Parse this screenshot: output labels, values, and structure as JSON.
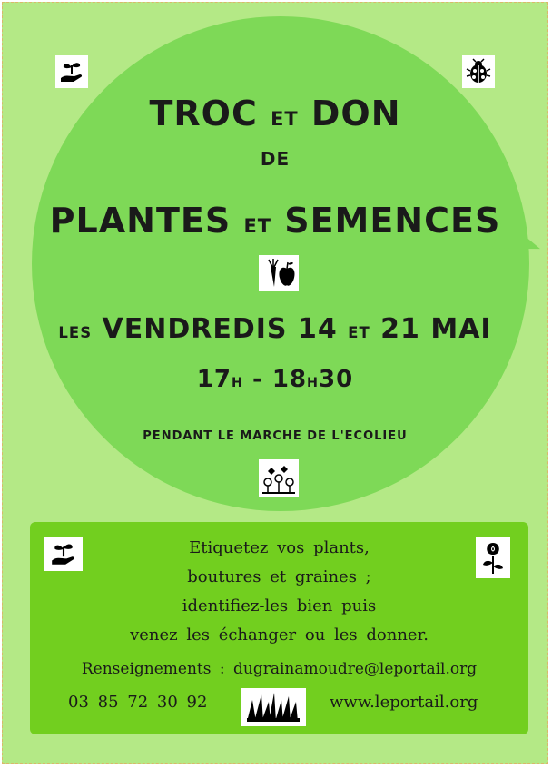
{
  "header": {
    "line1_a": "TROC",
    "line1_b": "ET",
    "line1_c": "DON",
    "line2": "DE",
    "line3_a": "PLANTES",
    "line3_b": "ET",
    "line3_c": "SEMENCES"
  },
  "dates": {
    "prefix": "LES",
    "main_a": "VENDREDIS 14",
    "mid": "ET",
    "main_b": "21 MAI"
  },
  "time": {
    "start": "17",
    "start_unit": "H",
    "dash": "-",
    "end_a": "18",
    "end_unit": "H",
    "end_b": "30"
  },
  "venue": "PENDANT LE MARCHE DE L'ECOLIEU",
  "panel": {
    "line1": "Etiquetez vos plants,",
    "line2": "boutures et graines ;",
    "line3": "identifiez-les bien puis",
    "line4": "venez les échanger ou les donner.",
    "info": "Renseignements : dugrainamoudre@leportail.org",
    "phone": "03 85 72 30 92",
    "website": "www.leportail.org"
  },
  "colors": {
    "background": "#b4e986",
    "bubble": "#7ed957",
    "panel": "#72cf1f",
    "text": "#1a1a1a"
  },
  "icons": [
    "seedling-hand-icon",
    "ladybug-icon",
    "carrot-apple-icon",
    "flowers-icon",
    "rose-icon",
    "grass-icon"
  ]
}
